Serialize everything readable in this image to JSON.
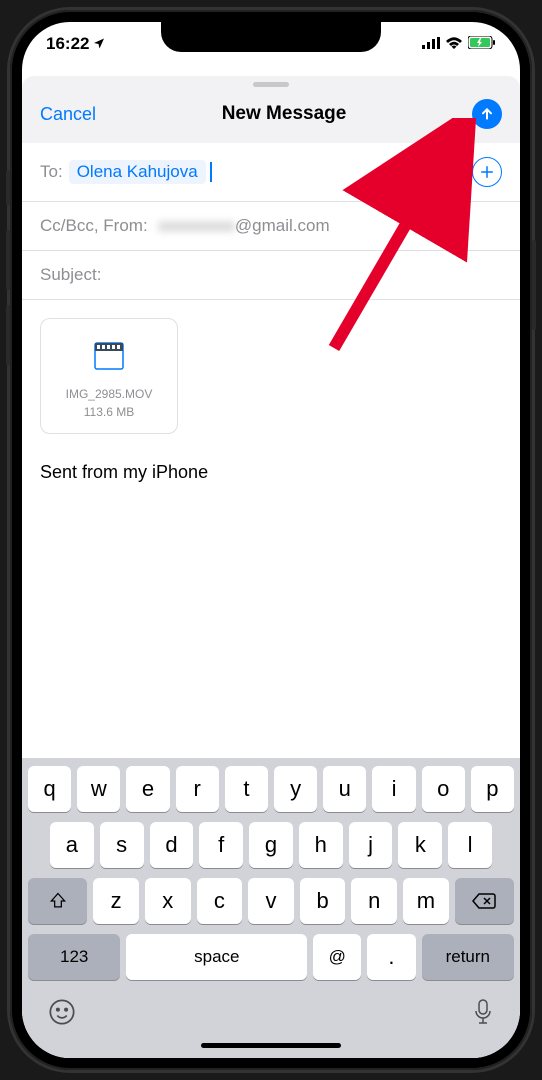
{
  "status": {
    "time": "16:22",
    "signal": "ıll",
    "wifi": "wifi",
    "battery": "charging"
  },
  "header": {
    "cancel": "Cancel",
    "title": "New Message"
  },
  "to": {
    "label": "To:",
    "recipient": "Olena Kahujova"
  },
  "cc": {
    "label": "Cc/Bcc, From:",
    "email_suffix": "@gmail.com"
  },
  "subject": {
    "label": "Subject:"
  },
  "attachment": {
    "filename": "IMG_2985.MOV",
    "size": "113.6 MB"
  },
  "signature": "Sent from my iPhone",
  "keyboard": {
    "row1": [
      "q",
      "w",
      "e",
      "r",
      "t",
      "y",
      "u",
      "i",
      "o",
      "p"
    ],
    "row2": [
      "a",
      "s",
      "d",
      "f",
      "g",
      "h",
      "j",
      "k",
      "l"
    ],
    "row3": [
      "z",
      "x",
      "c",
      "v",
      "b",
      "n",
      "m"
    ],
    "numbers": "123",
    "space": "space",
    "at": "@",
    "dot": ".",
    "return": "return"
  }
}
